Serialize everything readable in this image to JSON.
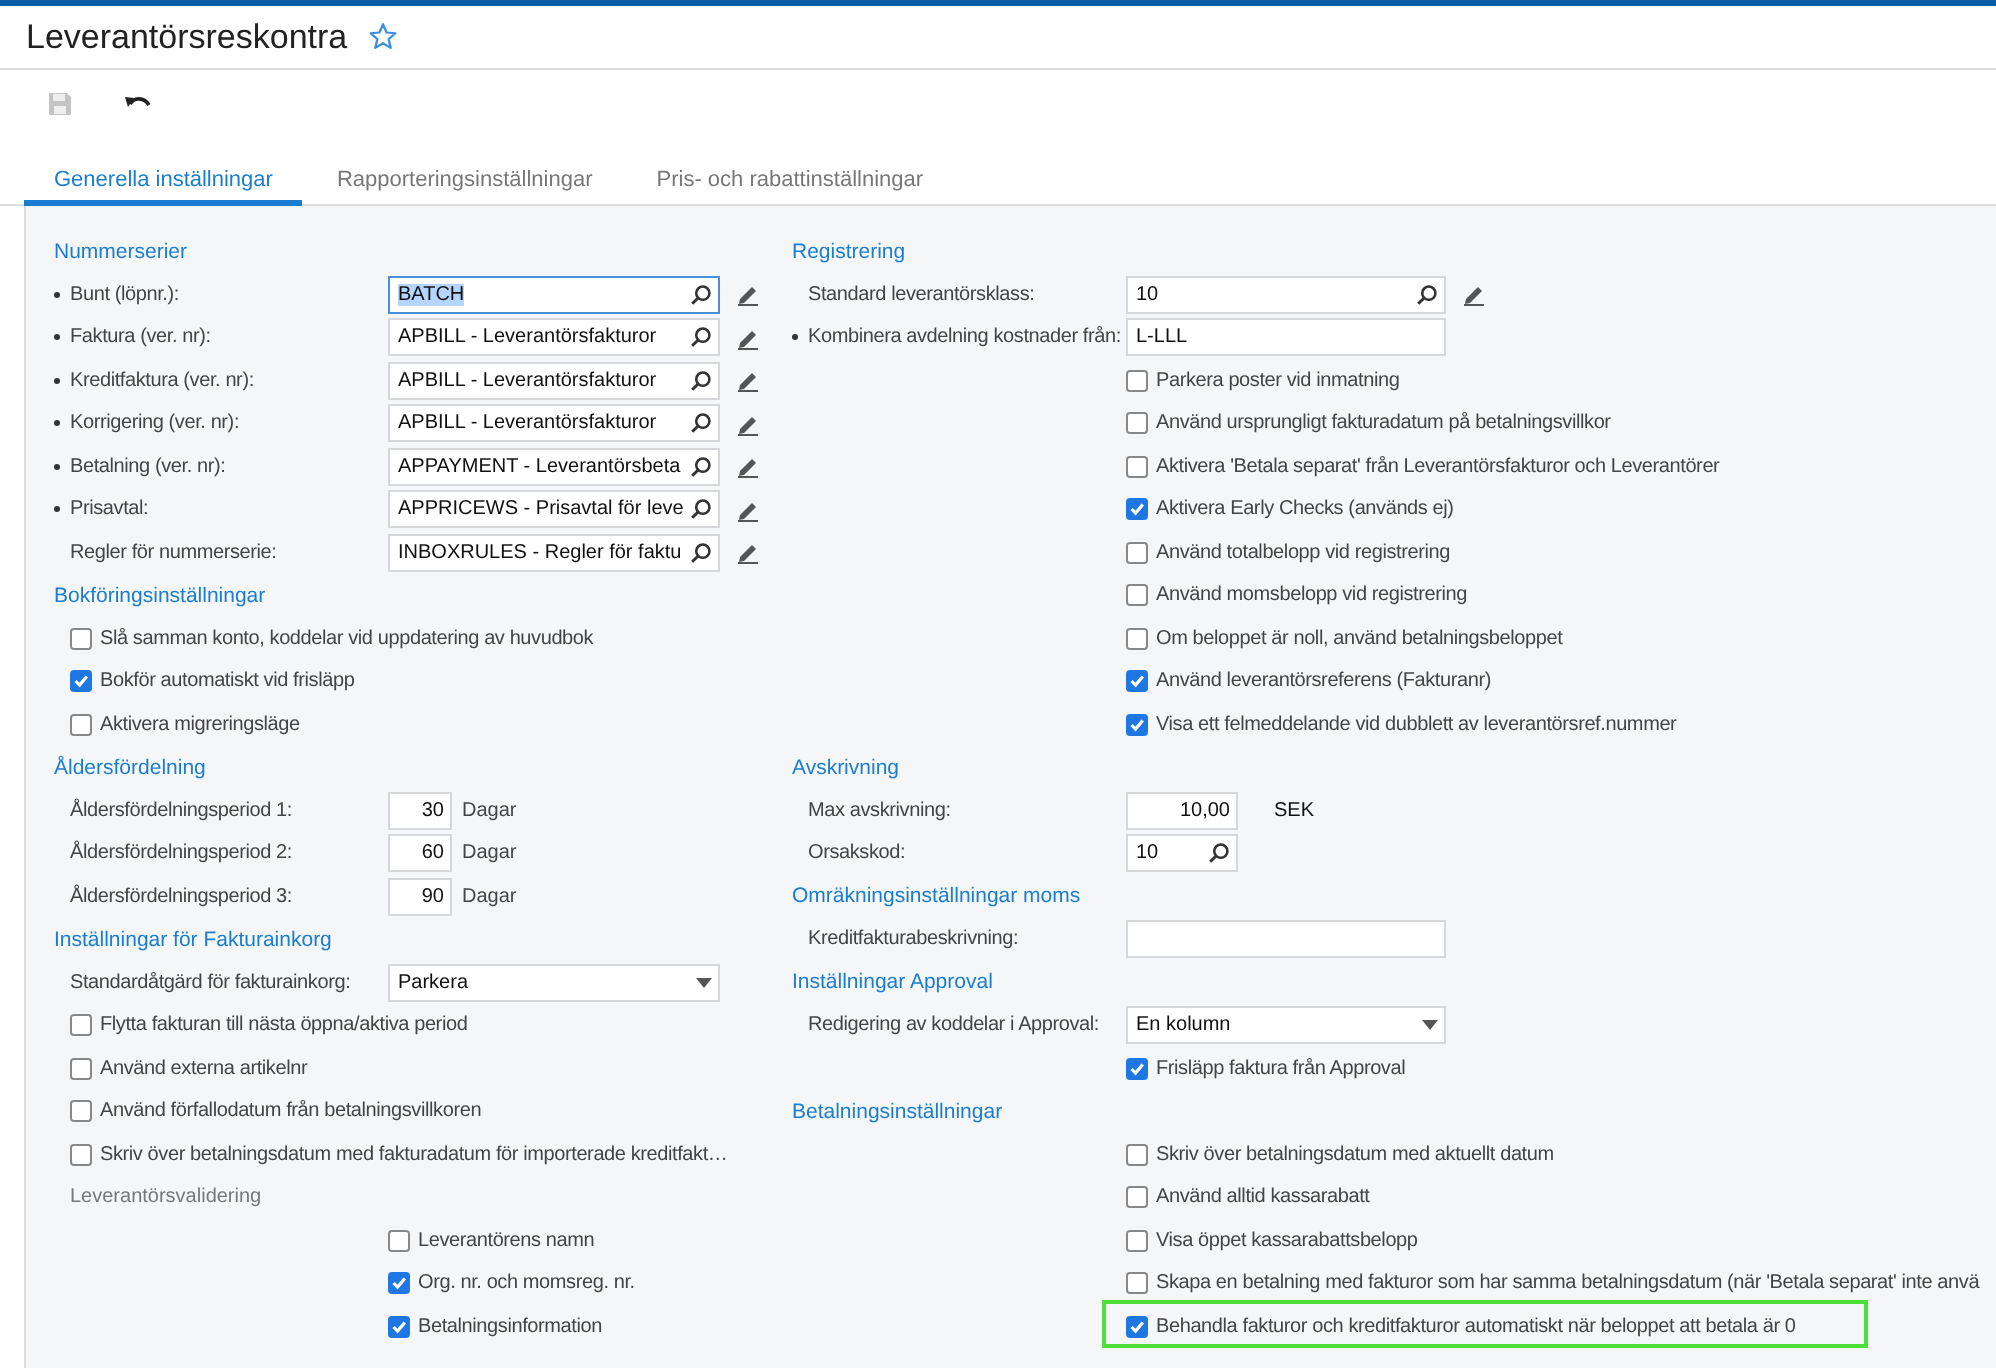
{
  "header": {
    "title": "Leverantörsreskontra"
  },
  "tabs": [
    {
      "label": "Generella inställningar",
      "selected": true
    },
    {
      "label": "Rapporteringsinställningar",
      "selected": false
    },
    {
      "label": "Pris- och rabattinställningar",
      "selected": false
    }
  ],
  "columns": [
    {
      "sections": [
        {
          "title": "Nummerserier",
          "rows": [
            {
              "kind": "lookup",
              "label": "Bunt (löpnr.):",
              "required": true,
              "value": "BATCH",
              "focused": true,
              "edit_button": true
            },
            {
              "kind": "lookup",
              "label": "Faktura (ver. nr):",
              "required": true,
              "value": "APBILL - Leverantörsfakturor",
              "focused": false,
              "edit_button": true
            },
            {
              "kind": "lookup",
              "label": "Kreditfaktura (ver. nr):",
              "required": true,
              "value": "APBILL - Leverantörsfakturor",
              "focused": false,
              "edit_button": true
            },
            {
              "kind": "lookup",
              "label": "Korrigering (ver. nr):",
              "required": true,
              "value": "APBILL - Leverantörsfakturor",
              "focused": false,
              "edit_button": true
            },
            {
              "kind": "lookup",
              "label": "Betalning (ver. nr):",
              "required": true,
              "value": "APPAYMENT - Leverantörsbeta",
              "focused": false,
              "edit_button": true
            },
            {
              "kind": "lookup",
              "label": "Prisavtal:",
              "required": true,
              "value": "APPRICEWS - Prisavtal för leve",
              "focused": false,
              "edit_button": true
            },
            {
              "kind": "lookup",
              "label": "Regler för nummerserie:",
              "required": false,
              "value": "INBOXRULES - Regler för faktu",
              "focused": false,
              "edit_button": true
            }
          ]
        },
        {
          "title": "Bokföringsinställningar",
          "rows": [
            {
              "kind": "checkbox",
              "label": "Slå samman konto, koddelar vid uppdatering av huvudbok",
              "checked": false
            },
            {
              "kind": "checkbox",
              "label": "Bokför automatiskt vid frisläpp",
              "checked": true
            },
            {
              "kind": "checkbox",
              "label": "Aktivera migreringsläge",
              "checked": false
            }
          ]
        },
        {
          "title": "Åldersfördelning",
          "rows": [
            {
              "kind": "number",
              "label": "Åldersfördelningsperiod 1:",
              "value": "30",
              "unit": "Dagar"
            },
            {
              "kind": "number",
              "label": "Åldersfördelningsperiod 2:",
              "value": "60",
              "unit": "Dagar"
            },
            {
              "kind": "number",
              "label": "Åldersfördelningsperiod 3:",
              "value": "90",
              "unit": "Dagar"
            }
          ]
        },
        {
          "title": "Inställningar för Fakturainkorg",
          "rows": [
            {
              "kind": "select",
              "label": "Standardåtgärd för fakturainkorg:",
              "value": "Parkera"
            },
            {
              "kind": "checkbox",
              "label": "Flytta fakturan till nästa öppna/aktiva period",
              "checked": false
            },
            {
              "kind": "checkbox",
              "label": "Använd externa artikelnr",
              "checked": false
            },
            {
              "kind": "checkbox",
              "label": "Använd förfallodatum från betalningsvillkoren",
              "checked": false
            },
            {
              "kind": "checkbox",
              "label": "Skriv över betalningsdatum med fakturadatum för importerade kreditfakt…",
              "checked": false
            },
            {
              "kind": "subheading",
              "label": "Leverantörsvalidering"
            },
            {
              "kind": "option",
              "label": "Leverantörens namn",
              "checked": false
            },
            {
              "kind": "option",
              "label": "Org. nr. och momsreg. nr.",
              "checked": true
            },
            {
              "kind": "option",
              "label": "Betalningsinformation",
              "checked": true
            }
          ]
        }
      ]
    },
    {
      "sections": [
        {
          "title": "Registrering",
          "rows": [
            {
              "kind": "lookup",
              "label": "Standard leverantörsklass:",
              "required": false,
              "value": "10",
              "focused": false,
              "edit_button": true
            },
            {
              "kind": "text",
              "label": "Kombinera avdelning kostnader från:",
              "required": true,
              "value": "L-LLL"
            },
            {
              "kind": "option",
              "label": "Parkera poster vid inmatning",
              "checked": false
            },
            {
              "kind": "option",
              "label": "Använd ursprungligt fakturadatum på betalningsvillkor",
              "checked": false
            },
            {
              "kind": "option",
              "label": "Aktivera 'Betala separat' från Leverantörsfakturor och Leverantörer",
              "checked": false
            },
            {
              "kind": "option",
              "label": "Aktivera Early Checks (används ej)",
              "checked": true
            },
            {
              "kind": "option",
              "label": "Använd totalbelopp vid registrering",
              "checked": false
            },
            {
              "kind": "option",
              "label": "Använd momsbelopp vid registrering",
              "checked": false
            },
            {
              "kind": "option",
              "label": "Om beloppet är noll, använd betalningsbeloppet",
              "checked": false
            },
            {
              "kind": "option",
              "label": "Använd leverantörsreferens (Fakturanr)",
              "checked": true
            },
            {
              "kind": "option",
              "label": "Visa ett felmeddelande vid dubblett av leverantörsref.nummer",
              "checked": true
            }
          ]
        },
        {
          "title": "Avskrivning",
          "rows": [
            {
              "kind": "amount",
              "label": "Max avskrivning:",
              "value": "10,00",
              "unit": "SEK"
            },
            {
              "kind": "small_lookup",
              "label": "Orsakskod:",
              "value": "10"
            }
          ]
        },
        {
          "title": "Omräkningsinställningar moms",
          "rows": [
            {
              "kind": "text",
              "label": "Kreditfakturabeskrivning:",
              "required": false
            }
          ]
        },
        {
          "title": "Inställningar Approval",
          "rows": [
            {
              "kind": "select",
              "label": "Redigering av koddelar i Approval:",
              "value": "En kolumn"
            },
            {
              "kind": "option",
              "label": "Frisläpp faktura från Approval",
              "checked": true
            }
          ]
        },
        {
          "title": "Betalningsinställningar",
          "rows": [
            {
              "kind": "option",
              "label": "Skriv över betalningsdatum med aktuellt datum",
              "checked": false,
              "highlighted": false
            },
            {
              "kind": "option",
              "label": "Använd alltid kassarabatt",
              "checked": false,
              "highlighted": false
            },
            {
              "kind": "option",
              "label": "Visa öppet kassarabattsbelopp",
              "checked": false,
              "highlighted": false
            },
            {
              "kind": "option",
              "label": "Skapa en betalning med fakturor som har samma betalningsdatum (när 'Betala separat' inte anvä",
              "checked": false,
              "highlighted": false
            },
            {
              "kind": "option",
              "label": "Behandla fakturor och kreditfakturor automatiskt när beloppet att betala är 0",
              "checked": true,
              "highlighted": true
            }
          ]
        }
      ]
    }
  ]
}
